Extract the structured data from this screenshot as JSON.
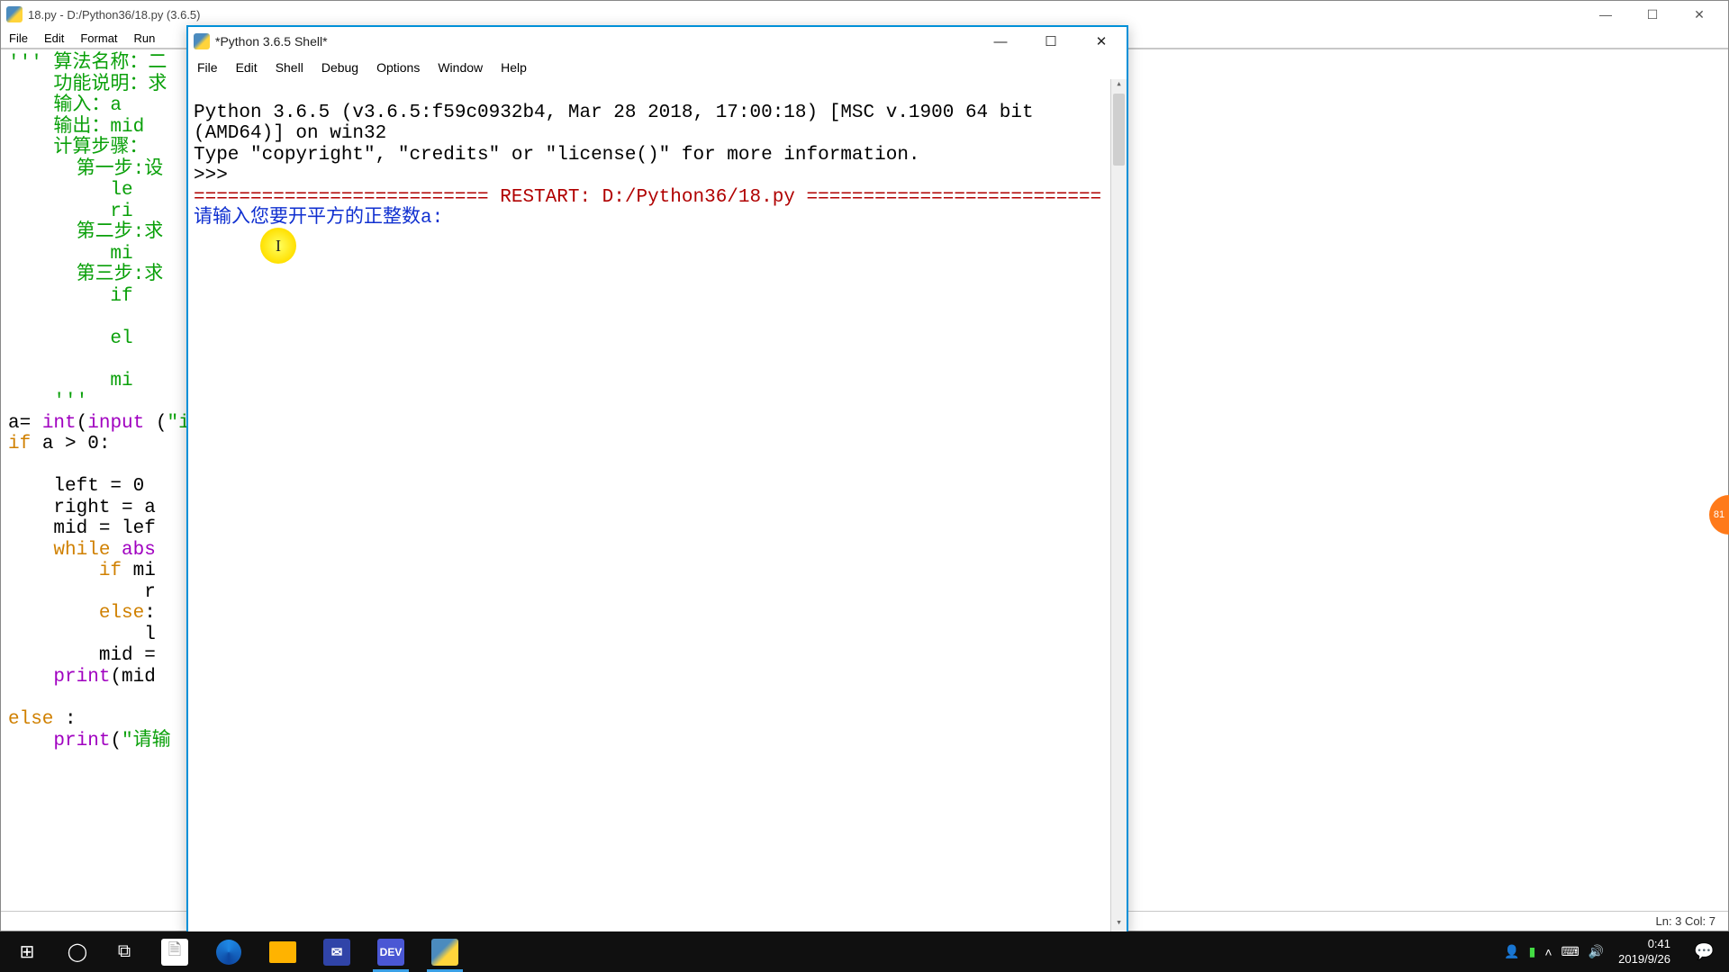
{
  "editor": {
    "title": "18.py - D:/Python36/18.py (3.6.5)",
    "menu": [
      "File",
      "Edit",
      "Format",
      "Run"
    ],
    "code": [
      {
        "c": "str",
        "t": "''' 算法名称：二"
      },
      {
        "c": "str",
        "t": "    功能说明：求"
      },
      {
        "c": "str",
        "t": "    输入：a"
      },
      {
        "c": "str",
        "t": "    输出：mid"
      },
      {
        "c": "str",
        "t": "    计算步骤："
      },
      {
        "c": "str",
        "t": "      第一步:设"
      },
      {
        "c": "str",
        "t": "         le"
      },
      {
        "c": "str",
        "t": "         ri"
      },
      {
        "c": "str",
        "t": "      第二步:求"
      },
      {
        "c": "str",
        "t": "         mi"
      },
      {
        "c": "str",
        "t": "      第三步:求"
      },
      {
        "c": "str",
        "t": "         if"
      },
      {
        "c": "",
        "t": ""
      },
      {
        "c": "str",
        "t": "         el"
      },
      {
        "c": "",
        "t": ""
      },
      {
        "c": "str",
        "t": "         mi"
      },
      {
        "c": "str",
        "t": "    '''"
      },
      {
        "c": "",
        "t": "a= <span class='func'>int</span>(<span class='func'>input</span> (<span class='str'>\"i</span>"
      },
      {
        "c": "",
        "t": "<span class='kw'>if</span> a &gt; 0:"
      },
      {
        "c": "",
        "t": ""
      },
      {
        "c": "",
        "t": "    left = 0"
      },
      {
        "c": "",
        "t": "    right = a"
      },
      {
        "c": "",
        "t": "    mid = lef"
      },
      {
        "c": "",
        "t": "    <span class='kw'>while</span> <span class='func'>abs</span>"
      },
      {
        "c": "",
        "t": "        <span class='kw'>if</span> mi"
      },
      {
        "c": "",
        "t": "            r"
      },
      {
        "c": "",
        "t": "        <span class='kw'>else</span>:"
      },
      {
        "c": "",
        "t": "            l"
      },
      {
        "c": "",
        "t": "        mid ="
      },
      {
        "c": "",
        "t": "    <span class='func'>print</span>(mid"
      },
      {
        "c": "",
        "t": ""
      },
      {
        "c": "",
        "t": "<span class='kw'>else</span> :"
      },
      {
        "c": "",
        "t": "    <span class='func'>print</span>(<span class='str'>\"请输</span>"
      }
    ],
    "status": "Ln: 3  Col: 7"
  },
  "shell": {
    "title": "*Python 3.6.5 Shell*",
    "menu": [
      "File",
      "Edit",
      "Shell",
      "Debug",
      "Options",
      "Window",
      "Help"
    ],
    "banner_line1": "Python 3.6.5 (v3.6.5:f59c0932b4, Mar 28 2018, 17:00:18) [MSC v.1900 64 bit (AMD64)] on win32",
    "banner_line2": "Type \"copyright\", \"credits\" or \"license()\" for more information.",
    "prompt": ">>> ",
    "restart_line": "========================== RESTART: D:/Python36/18.py ==========================",
    "input_prompt": "请输入您要开平方的正整数a: "
  },
  "taskbar": {
    "apps": [
      "file",
      "edge",
      "folder",
      "outlook",
      "dev",
      "py"
    ],
    "clock_time": "0:41",
    "clock_date": "2019/9/26"
  },
  "badge": "81",
  "marker_label": "I"
}
